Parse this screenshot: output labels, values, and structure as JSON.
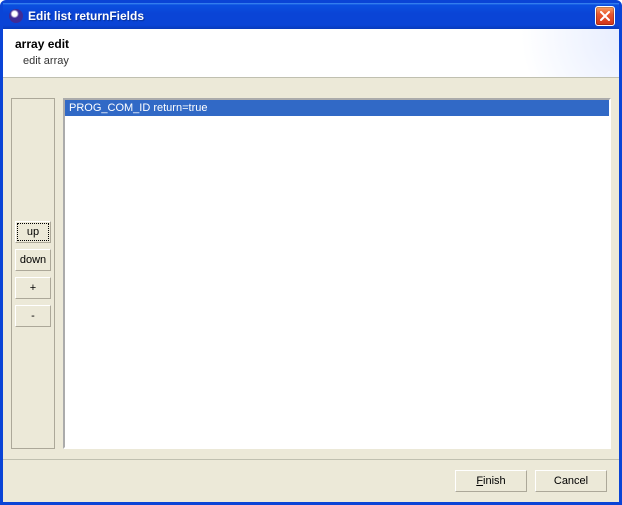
{
  "window": {
    "title": "Edit list returnFields"
  },
  "header": {
    "title": "array edit",
    "subtitle": "edit array"
  },
  "sideButtons": {
    "up": "up",
    "down": "down",
    "add": "+",
    "remove": "-"
  },
  "list": {
    "items": [
      {
        "label": "PROG_COM_ID return=true",
        "selected": true
      }
    ]
  },
  "footer": {
    "finish": "Finish",
    "cancel": "Cancel"
  }
}
